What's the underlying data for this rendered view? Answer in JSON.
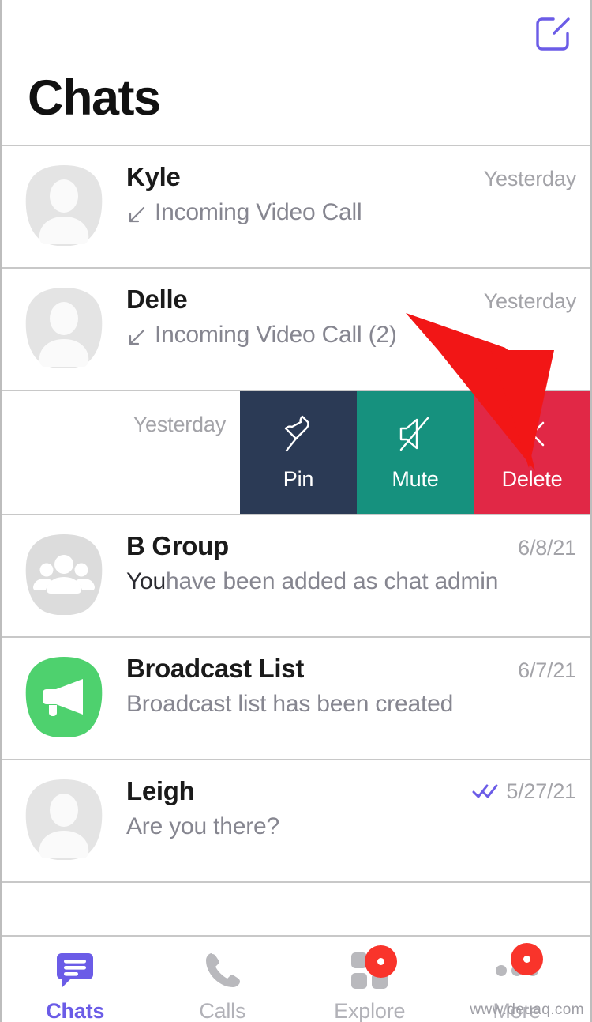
{
  "header": {
    "title": "Chats",
    "compose_icon": "compose-icon"
  },
  "colors": {
    "accent_purple": "#6b5ce7",
    "pin_navy": "#2b3a55",
    "mute_teal": "#16917e",
    "delete_red": "#e12846",
    "badge_red": "#f9342b",
    "broadcast_green": "#4ed16e",
    "annotation_red": "#f21616",
    "avatar_gray": "#e2e2e2"
  },
  "chats": [
    {
      "name": "Kyle",
      "preview_strong": "",
      "preview": "Incoming Video Call",
      "time": "Yesterday",
      "avatar": "person-avatar-icon",
      "has_call_arrow": true,
      "read_receipt": false
    },
    {
      "name": "Delle",
      "preview_strong": "",
      "preview": "Incoming Video Call (2)",
      "time": "Yesterday",
      "avatar": "person-avatar-icon",
      "has_call_arrow": true,
      "read_receipt": false
    },
    {
      "name": "B Group",
      "preview_strong": "You",
      "preview": " have been added as chat admin",
      "time": "6/8/21",
      "avatar": "group-avatar-icon",
      "has_call_arrow": false,
      "read_receipt": false
    },
    {
      "name": "Broadcast List",
      "preview_strong": "",
      "preview": "Broadcast list has been created",
      "time": "6/7/21",
      "avatar": "broadcast-megaphone-icon",
      "has_call_arrow": false,
      "read_receipt": false
    },
    {
      "name": "Leigh",
      "preview_strong": "",
      "preview": "Are you there?",
      "time": "5/27/21",
      "avatar": "person-avatar-icon",
      "has_call_arrow": false,
      "read_receipt": true
    }
  ],
  "swipe_row": {
    "time": "Yesterday",
    "actions": [
      {
        "label": "Pin",
        "icon": "pin-icon",
        "color": "#2b3a55"
      },
      {
        "label": "Mute",
        "icon": "mute-speaker-icon",
        "color": "#16917e"
      },
      {
        "label": "Delete",
        "icon": "close-x-icon",
        "color": "#e12846"
      }
    ]
  },
  "tabbar": {
    "tabs": [
      {
        "label": "Chats",
        "icon": "chat-bubble-icon",
        "active": true,
        "badge": false
      },
      {
        "label": "Calls",
        "icon": "phone-handset-icon",
        "active": false,
        "badge": false
      },
      {
        "label": "Explore",
        "icon": "grid-squares-icon",
        "active": false,
        "badge": true
      },
      {
        "label": "More",
        "icon": "ellipsis-dots-icon",
        "active": false,
        "badge": true
      }
    ]
  },
  "watermark": {
    "text": "www.deuaq.com"
  }
}
